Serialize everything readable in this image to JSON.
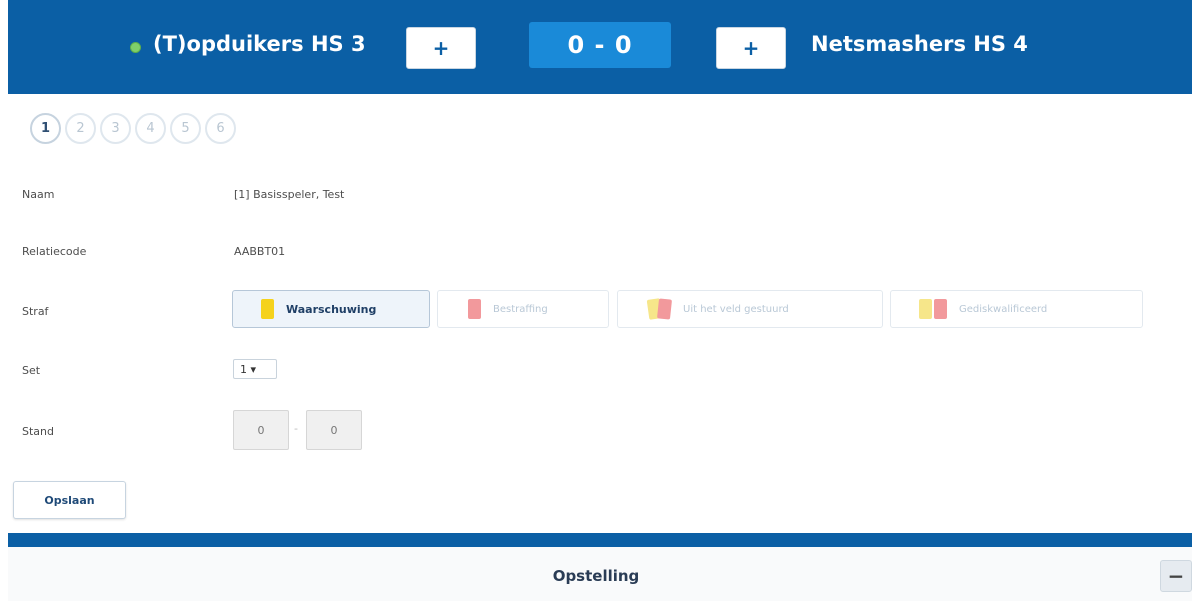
{
  "header": {
    "home_team": "(T)opduikers HS 3",
    "away_team": "Netsmashers HS 4",
    "score": "0 - 0",
    "home_plus": "+",
    "away_plus": "+",
    "status_color": "#7fd06a"
  },
  "sets": [
    "1",
    "2",
    "3",
    "4",
    "5",
    "6"
  ],
  "active_set": "1",
  "form": {
    "name_label": "Naam",
    "name_value": "[1]  Basisspeler, Test",
    "code_label": "Relatiecode",
    "code_value": "AABBT01",
    "penalty_label": "Straf",
    "penalties": [
      {
        "label": "Waarschuwing",
        "cards": [
          "yellow"
        ],
        "active": true
      },
      {
        "label": "Bestraffing",
        "cards": [
          "red"
        ],
        "active": false
      },
      {
        "label": "Uit het veld gestuurd",
        "cards": [
          "yellow",
          "red"
        ],
        "active": false
      },
      {
        "label": "Gediskwalificeerd",
        "cards": [
          "yellow",
          "red"
        ],
        "active": false
      }
    ],
    "set_label": "Set",
    "set_value": "1 ▾",
    "score_label": "Stand",
    "score_home": "0",
    "score_sep": "-",
    "score_away": "0"
  },
  "save_button": "Opslaan",
  "section": {
    "title": "Opstelling",
    "collapse": "−"
  },
  "colors": {
    "header_blue": "#0b5fa5",
    "score_blue": "#1a8ad8",
    "yellow_card": "#f5d21c",
    "red_card": "#f2999c"
  }
}
